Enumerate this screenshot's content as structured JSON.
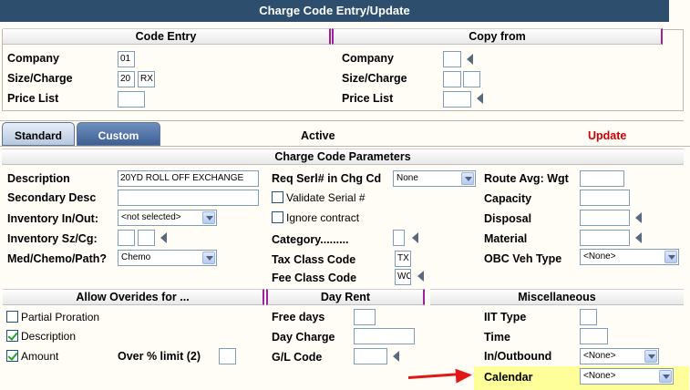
{
  "window": {
    "title": "Charge Code Entry/Update"
  },
  "code_entry": {
    "header": "Code Entry",
    "company_label": "Company",
    "company_value": "01",
    "size_charge_label": "Size/Charge",
    "size_value": "20",
    "charge_value": "RX",
    "price_list_label": "Price List",
    "price_list_value": ""
  },
  "copy_from": {
    "header": "Copy from",
    "company_label": "Company",
    "size_charge_label": "Size/Charge",
    "price_list_label": "Price List"
  },
  "tabs": [
    {
      "label": "Standard",
      "active": true
    },
    {
      "label": "Custom",
      "active": false
    }
  ],
  "status": {
    "active": "Active",
    "mode": "Update",
    "mode_color": "#cc0000"
  },
  "params": {
    "header": "Charge Code Parameters",
    "description_label": "Description",
    "description_value": "20YD ROLL OFF EXCHANGE",
    "secondary_desc_label": "Secondary Desc",
    "secondary_desc_value": "",
    "inventory_inout_label": "Inventory In/Out:",
    "inventory_inout_value": "<not selected>",
    "inventory_szcg_label": "Inventory Sz/Cg:",
    "med_chemo_label": "Med/Chemo/Path?",
    "med_chemo_value": "Chemo",
    "req_serl_label": "Req Serl# in Chg Cd",
    "req_serl_value": "None",
    "validate_serial_label": "Validate Serial #",
    "ignore_contract_label": "Ignore contract",
    "category_label": "Category.........",
    "tax_class_label": "Tax Class Code",
    "tax_class_value": "TX",
    "fee_class_label": "Fee Class Code",
    "fee_class_value": "WO",
    "route_avg_label": "Route Avg: Wgt",
    "capacity_label": "Capacity",
    "disposal_label": "Disposal",
    "material_label": "Material",
    "obc_veh_label": "OBC Veh Type",
    "obc_veh_value": "<None>"
  },
  "overrides": {
    "header": "Allow Overides for ...",
    "partial_proration_label": "Partial Proration",
    "partial_proration_checked": false,
    "description_label": "Description",
    "description_checked": true,
    "amount_label": "Amount",
    "amount_checked": true,
    "over_limit_label": "Over % limit (2)"
  },
  "day_rent": {
    "header": "Day Rent",
    "free_days_label": "Free days",
    "day_charge_label": "Day Charge",
    "gl_code_label": "G/L Code"
  },
  "misc": {
    "header": "Miscellaneous",
    "iit_type_label": "IIT Type",
    "time_label": "Time",
    "in_outbound_label": "In/Outbound",
    "in_outbound_value": "<None>",
    "calendar_label": "Calendar",
    "calendar_value": "<None>"
  },
  "colors": {
    "titlebar": "#2d4e6c",
    "section_accent": "#a020a0",
    "highlight": "#ffff99",
    "arrow": "#e01818"
  }
}
